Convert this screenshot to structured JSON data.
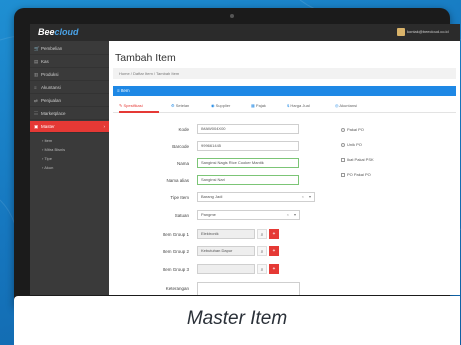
{
  "app": {
    "brand_prefix": "Bee",
    "brand_suffix": "cloud",
    "user_email": "kontak@beecloud.co.id"
  },
  "sidebar": {
    "items": [
      {
        "icon": "🛒",
        "label": "Pembelian"
      },
      {
        "icon": "▤",
        "label": "Kas"
      },
      {
        "icon": "▥",
        "label": "Produksi"
      },
      {
        "icon": "≡",
        "label": "Akuntansi"
      },
      {
        "icon": "⇄",
        "label": "Penjualan"
      },
      {
        "icon": "☷",
        "label": "Marketplace"
      },
      {
        "icon": "▣",
        "label": "Master"
      }
    ],
    "sub_items": [
      "› Item",
      "› Mitra Bisnis",
      "› Tipe",
      "› Akun"
    ]
  },
  "content": {
    "title": "Tambah Item",
    "breadcrumb": "Home  /  Daftar Item  /  Tambah Item",
    "panel_title": "Item",
    "tabs": [
      {
        "icon": "✎",
        "label": "Spesifikasi"
      },
      {
        "icon": "⚙",
        "label": "Setelan"
      },
      {
        "icon": "◉",
        "label": "Supplier"
      },
      {
        "icon": "▦",
        "label": "Pajak"
      },
      {
        "icon": "$",
        "label": "Harga Jual"
      },
      {
        "icon": "◎",
        "label": "Akuntansi"
      }
    ]
  },
  "form": {
    "kode": {
      "label": "Kode",
      "value": "IMAW004X00"
    },
    "barcode": {
      "label": "Barcode",
      "value": "999661445"
    },
    "nama": {
      "label": "Nama",
      "value": "Sanginsi Nagis Rice Cooker Mantik"
    },
    "nama_alias": {
      "label": "Nama alias",
      "value": "Sanginsi Nari"
    },
    "tipe_item": {
      "label": "Tipe Item",
      "value": "Barang Jadi"
    },
    "satuan": {
      "label": "Satuan",
      "value": "Pangme"
    },
    "item_group_1": {
      "label": "Item Group 1",
      "value": "Elektronik"
    },
    "item_group_2": {
      "label": "Item Group 2",
      "value": "Kebutuhan Dapur"
    },
    "item_group_3": {
      "label": "Item Group 3",
      "value": ""
    },
    "keterangan": {
      "label": "Keterangan",
      "value": ""
    },
    "search_icon_glyph": "⌕",
    "add_icon_glyph": "+",
    "clear_glyph": "×",
    "arrow_glyph": "▾"
  },
  "options": [
    {
      "type": "radio",
      "label": "Pakai PO"
    },
    {
      "type": "radio",
      "label": "Unik PO"
    },
    {
      "type": "check",
      "label": "Ikat Pakai PSK"
    },
    {
      "type": "check",
      "label": "PO Pakai PO"
    }
  ],
  "caption": "Master Item"
}
